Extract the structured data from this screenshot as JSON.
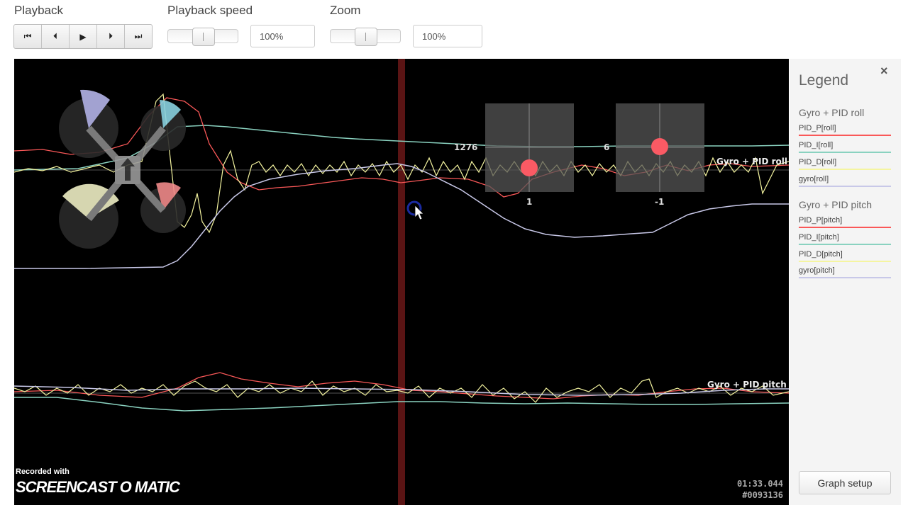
{
  "toolbar": {
    "playback_label": "Playback",
    "speed_label": "Playback speed",
    "zoom_label": "Zoom",
    "speed_value": "100%",
    "zoom_value": "100%",
    "buttons": [
      "skip-to-start",
      "step-back",
      "play",
      "step-forward",
      "skip-to-end"
    ]
  },
  "graph": {
    "roll_label": "Gyro + PID roll",
    "pitch_label": "Gyro + PID pitch",
    "stick_left_x": "1276",
    "stick_left_bottom": "1",
    "stick_right_x": "6",
    "stick_right_bottom": "-1",
    "time": "01:33.044",
    "frame": "#0093136",
    "watermark_small": "Recorded with",
    "watermark_big": "SCREENCAST O MATIC"
  },
  "legend": {
    "title": "Legend",
    "close_icon": "×",
    "groups": [
      {
        "name": "Gyro + PID roll",
        "items": [
          "PID_P[roll]",
          "PID_I[roll]",
          "PID_D[roll]",
          "gyro[roll]"
        ]
      },
      {
        "name": "Gyro + PID pitch",
        "items": [
          "PID_P[pitch]",
          "PID_I[pitch]",
          "PID_D[pitch]",
          "gyro[pitch]"
        ]
      }
    ],
    "colors": [
      "#fa5858",
      "#8ad2c0",
      "#f5f5a0",
      "#c8c8e8"
    ],
    "setup_button": "Graph setup"
  }
}
